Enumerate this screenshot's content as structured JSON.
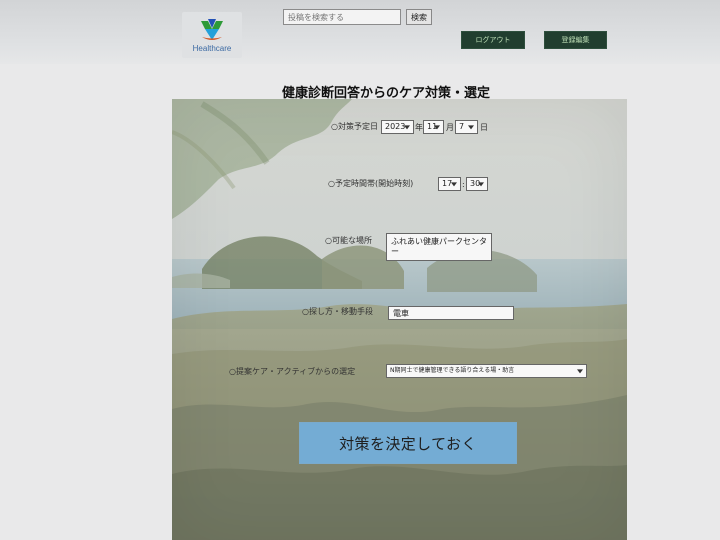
{
  "header": {
    "logo_text": "Healthcare",
    "search": {
      "placeholder": "投稿を検索する",
      "button_label": "検索"
    },
    "logout_label": "ログアウト",
    "account_label": "登録編集"
  },
  "page": {
    "title": "健康診断回答からのケア対策・選定"
  },
  "form": {
    "date": {
      "label": "対策予定日",
      "year": "2023",
      "year_suffix": "年",
      "month": "11",
      "month_suffix": "月",
      "day": "7",
      "day_suffix": "日"
    },
    "time": {
      "label": "予定時間帯(開始時刻)",
      "hour": "17",
      "minute": "30"
    },
    "place": {
      "label": "可能な場所",
      "value": "ふれあい健康パークセンター"
    },
    "transport": {
      "label": "探し方・移動手段",
      "value": "電車"
    },
    "proposal": {
      "label": "提案ケア・アクティブからの選定",
      "value": "N期同士で健康管理できる語り合える場・助言"
    },
    "submit_label": "対策を決定しておく"
  },
  "colors": {
    "header_button_bg": "#213e2f",
    "header_button_text": "#bfe0b7",
    "submit_bg": "#74acd4"
  }
}
